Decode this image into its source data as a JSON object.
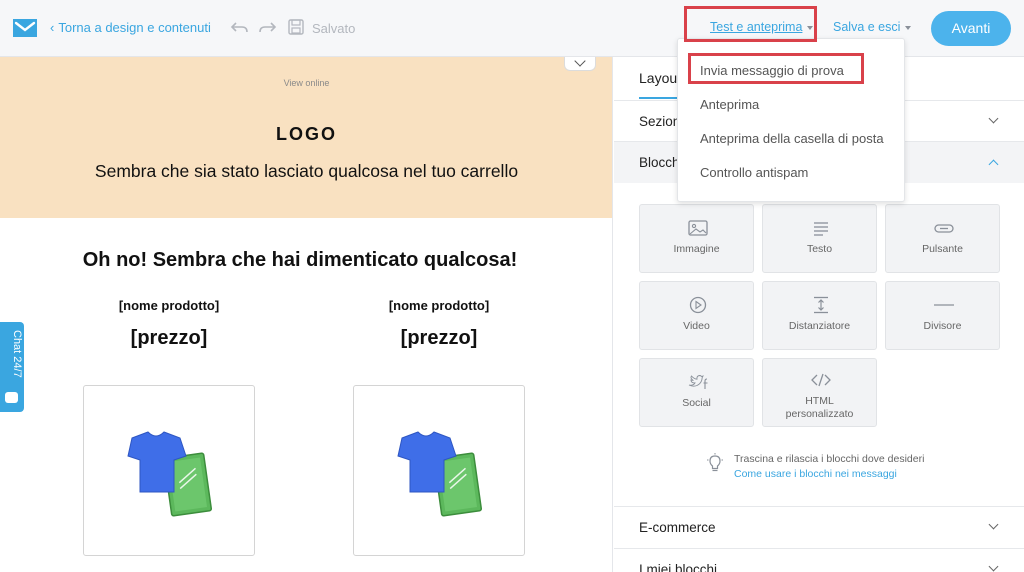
{
  "topbar": {
    "back_label": "Torna a design e contenuti",
    "saved_label": "Salvato",
    "test_preview_label": "Test e anteprima",
    "save_exit_label": "Salva e esci",
    "next_label": "Avanti"
  },
  "dropdown": {
    "items": [
      {
        "label": "Invia messaggio di prova",
        "highlighted": true
      },
      {
        "label": "Anteprima"
      },
      {
        "label": "Anteprima della casella di posta"
      },
      {
        "label": "Controllo antispam"
      }
    ]
  },
  "email": {
    "view_online": "View online",
    "logo_text": "LOGO",
    "hero_subtitle": "Sembra che sia stato lasciato qualcosa nel tuo carrello",
    "heading": "Oh no! Sembra che hai dimenticato qualcosa!",
    "products": [
      {
        "name": "[nome prodotto]",
        "price": "[prezzo]"
      },
      {
        "name": "[nome prodotto]",
        "price": "[prezzo]"
      }
    ]
  },
  "chat": {
    "label": "Chat 24/7"
  },
  "panel": {
    "tab_label": "Layout",
    "sections": {
      "sezioni": "Sezioni",
      "blocchi": "Blocchi",
      "ecommerce": "E-commerce",
      "my_blocks": "I miei blocchi"
    },
    "blocks": [
      {
        "label": "Immagine",
        "icon": "image-icon"
      },
      {
        "label": "Testo",
        "icon": "text-lines-icon"
      },
      {
        "label": "Pulsante",
        "icon": "button-icon"
      },
      {
        "label": "Video",
        "icon": "play-icon"
      },
      {
        "label": "Distanziatore",
        "icon": "spacer-icon"
      },
      {
        "label": "Divisore",
        "icon": "divider-icon"
      },
      {
        "label": "Social",
        "icon": "social-icon"
      },
      {
        "label": "HTML personalizzato",
        "icon": "code-icon"
      }
    ],
    "hint_text": "Trascina e rilascia i blocchi dove desideri",
    "hint_link": "Come usare i blocchi nei messaggi"
  },
  "colors": {
    "accent": "#3aa6e0",
    "highlight": "#d9414a",
    "hero_bg": "#f9e1c1"
  }
}
